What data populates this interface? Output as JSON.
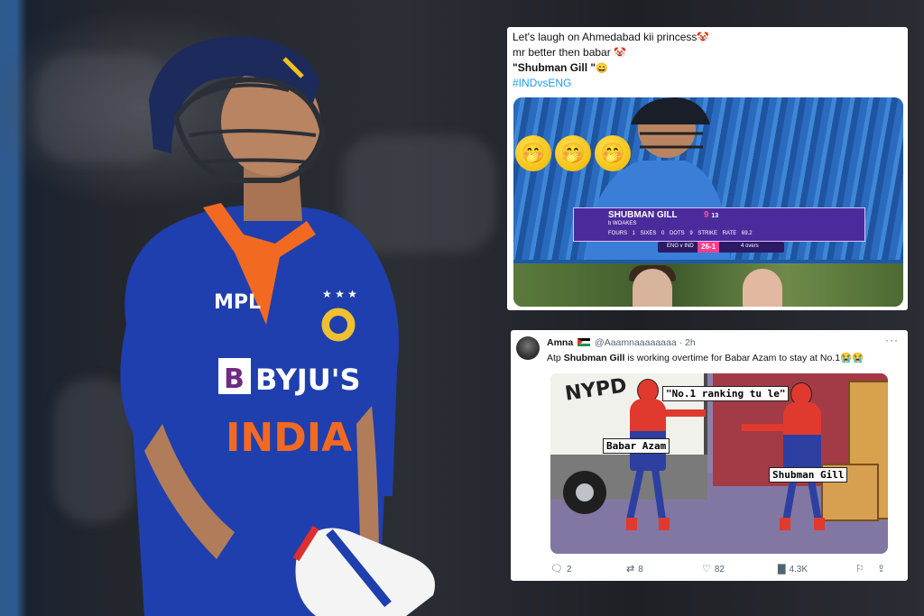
{
  "tweet1": {
    "line1": "Let's laugh on Ahmedabad kii princess",
    "line1_emoji": "🤡",
    "line2": "mr better then babar",
    "line2_emoji": "🤡",
    "line3_name": "\"Shubman Gill \"",
    "line3_emoji": "😄",
    "hashtag": "#INDvsENG",
    "media": {
      "player_name": "SHUBMAN GILL",
      "runs": "9",
      "balls": "13",
      "dismissal": "b WOAKES",
      "stats": "FOURS 1  SIXES 0  DOTS 9  STRIKE RATE 69.2",
      "team_label": "ENG v IND",
      "team_score": "26-1",
      "overs": "4 overs",
      "reaction_emoji": "🤭"
    }
  },
  "tweet2": {
    "display_name": "Amna",
    "handle": "@Aaamnaaaaaaaa",
    "time": "· 2h",
    "more": "···",
    "text_pre": "Atp",
    "text_bold": "Shubman Gill",
    "text_post": "is working overtime for Babar Azam to stay at No.1",
    "text_emoji": "😭😭",
    "meme": {
      "truck_text": "NYPD",
      "quote_label": "\"No.1 ranking tu le\"",
      "left_label": "Babar Azam",
      "right_label": "Shubman Gill"
    },
    "actions": {
      "replies": "2",
      "retweets": "8",
      "likes": "82",
      "views": "4.3K"
    }
  },
  "player_photo": {
    "jersey_brand": "MPL",
    "jersey_sponsor": "BYJU'S",
    "jersey_country": "INDIA"
  },
  "colors": {
    "jersey_blue": "#1f3fae",
    "jersey_orange": "#f26a21",
    "twitter_blue": "#1d9bf0"
  }
}
